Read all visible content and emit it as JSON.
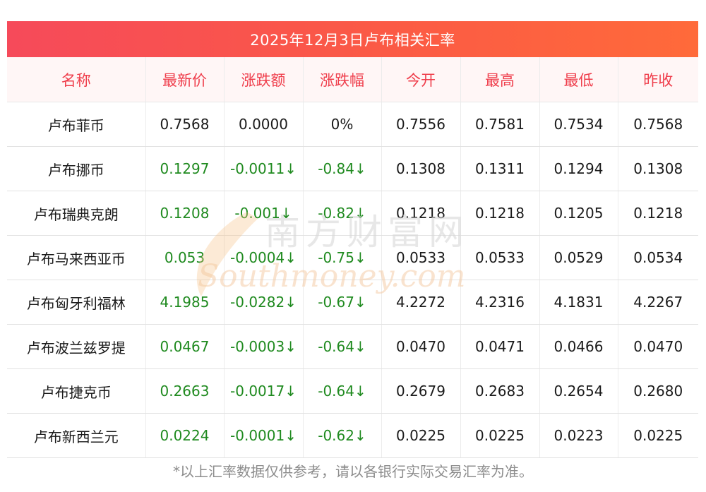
{
  "title": "2025年12月3日卢布相关汇率",
  "headers": [
    "名称",
    "最新价",
    "涨跌额",
    "涨跌幅",
    "今开",
    "最高",
    "最低",
    "昨收"
  ],
  "rows": [
    {
      "name": "卢布菲币",
      "latest": "0.7568",
      "change": "0.0000",
      "pct": "0%",
      "open": "0.7556",
      "high": "0.7581",
      "low": "0.7534",
      "prev": "0.7568",
      "dir": "flat"
    },
    {
      "name": "卢布挪币",
      "latest": "0.1297",
      "change": "-0.0011↓",
      "pct": "-0.84↓",
      "open": "0.1308",
      "high": "0.1311",
      "low": "0.1294",
      "prev": "0.1308",
      "dir": "down"
    },
    {
      "name": "卢布瑞典克朗",
      "latest": "0.1208",
      "change": "-0.001↓",
      "pct": "-0.82↓",
      "open": "0.1218",
      "high": "0.1218",
      "low": "0.1205",
      "prev": "0.1218",
      "dir": "down"
    },
    {
      "name": "卢布马来西亚币",
      "latest": "0.053",
      "change": "-0.0004↓",
      "pct": "-0.75↓",
      "open": "0.0533",
      "high": "0.0533",
      "low": "0.0529",
      "prev": "0.0534",
      "dir": "down"
    },
    {
      "name": "卢布匈牙利福林",
      "latest": "4.1985",
      "change": "-0.0282↓",
      "pct": "-0.67↓",
      "open": "4.2272",
      "high": "4.2316",
      "low": "4.1831",
      "prev": "4.2267",
      "dir": "down"
    },
    {
      "name": "卢布波兰兹罗提",
      "latest": "0.0467",
      "change": "-0.0003↓",
      "pct": "-0.64↓",
      "open": "0.0470",
      "high": "0.0471",
      "low": "0.0466",
      "prev": "0.0470",
      "dir": "down"
    },
    {
      "name": "卢布捷克币",
      "latest": "0.2663",
      "change": "-0.0017↓",
      "pct": "-0.64↓",
      "open": "0.2679",
      "high": "0.2683",
      "low": "0.2654",
      "prev": "0.2680",
      "dir": "down"
    },
    {
      "name": "卢布新西兰元",
      "latest": "0.0224",
      "change": "-0.0001↓",
      "pct": "-0.62↓",
      "open": "0.0225",
      "high": "0.0225",
      "low": "0.0223",
      "prev": "0.0225",
      "dir": "down"
    }
  ],
  "footer": "*以上汇率数据仅供参考，请以各银行实际交易汇率为准。",
  "watermark": {
    "cn": "南方财富网",
    "en": "Southmoney.com"
  },
  "colors": {
    "header_gradient_start": "#f64a5a",
    "header_gradient_end": "#ff6a3a",
    "header_text": "#ef3d4b",
    "down": "#1f8a1f"
  }
}
